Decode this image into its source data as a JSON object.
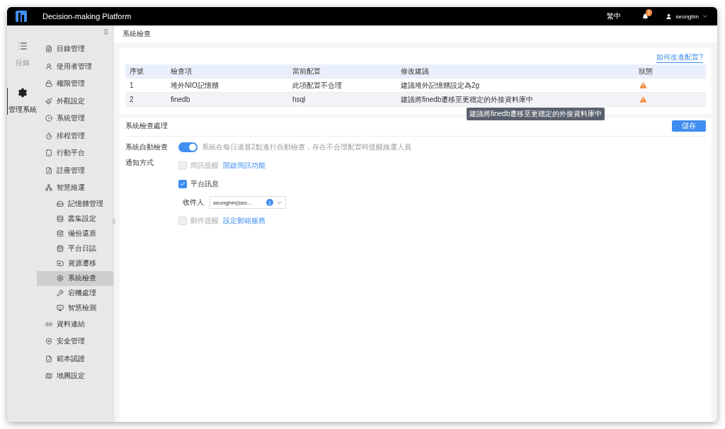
{
  "topbar": {
    "title": "Decision-making Platform",
    "language": "繁中",
    "notification_count": "2",
    "user": "seongbin"
  },
  "rail": [
    {
      "label": "目錄",
      "selected": false
    },
    {
      "label": "管理系統",
      "selected": true
    }
  ],
  "menu": [
    {
      "label": "目錄管理",
      "selected": false
    },
    {
      "label": "使用者管理",
      "selected": false
    },
    {
      "label": "權限管理",
      "selected": false
    },
    {
      "label": "外觀設定",
      "selected": false
    },
    {
      "label": "系統管理",
      "selected": false
    },
    {
      "label": "排程管理",
      "selected": false
    },
    {
      "label": "行動平台",
      "selected": false
    },
    {
      "label": "註冊管理",
      "selected": false
    },
    {
      "label": "智慧維運",
      "selected": false,
      "children": [
        {
          "label": "記憶體管理",
          "selected": false
        },
        {
          "label": "叢集設定",
          "selected": false
        },
        {
          "label": "備份還原",
          "selected": false
        },
        {
          "label": "平台日誌",
          "selected": false
        },
        {
          "label": "資源遷移",
          "selected": false
        },
        {
          "label": "系統檢查",
          "selected": true
        },
        {
          "label": "宕機處理",
          "selected": false
        },
        {
          "label": "智慧檢測",
          "selected": false
        }
      ]
    },
    {
      "label": "資料連結",
      "selected": false
    },
    {
      "label": "安全管理",
      "selected": false
    },
    {
      "label": "範本認證",
      "selected": false
    },
    {
      "label": "地圖設定",
      "selected": false
    }
  ],
  "breadcrumb": "系統檢查",
  "check": {
    "help_link": "如何改進配置?",
    "columns": [
      "序號",
      "檢查項",
      "當前配置",
      "修改建議",
      "狀態"
    ],
    "rows": [
      {
        "cells": [
          "1",
          "堆外NIO記憶體",
          "此項配置不合理",
          "建議堆外記憶體設定為2g"
        ]
      },
      {
        "cells": [
          "2",
          "finedb",
          "hsql",
          "建議將finedb遷移至更穩定的外接資料庫中"
        ]
      }
    ],
    "tooltip": "建議將finedb遷移至更穩定的外接資料庫中"
  },
  "settings": {
    "title": "系統檢查處理",
    "save": "儲存",
    "auto_check": {
      "label": "系統自動檢查",
      "on": true,
      "description": "系統在每日凌晨2點進行自動檢查，存在不合理配置時提醒維運人員"
    },
    "notify_label": "通知方式",
    "options": [
      {
        "kind": "checkbox",
        "label": "簡訊提醒",
        "checked": false,
        "disabled": true,
        "link": "開啟簡訊功能"
      },
      {
        "kind": "checkbox",
        "label": "平台訊息",
        "checked": true,
        "disabled": false
      },
      {
        "kind": "recipient",
        "label": "收件人",
        "value": "seongbin(seo...",
        "count": "1"
      },
      {
        "kind": "checkbox",
        "label": "郵件提醒",
        "checked": false,
        "disabled": true,
        "link": "設定郵箱服務"
      }
    ]
  }
}
